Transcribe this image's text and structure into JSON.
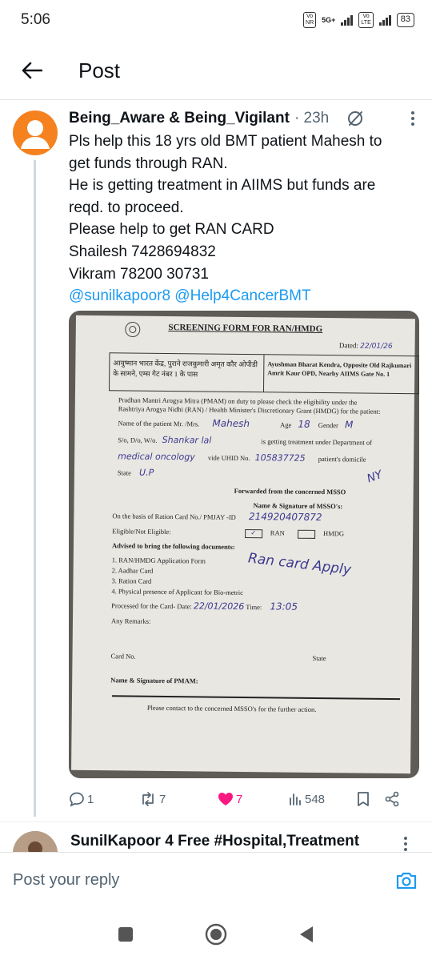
{
  "status_bar": {
    "time": "5:06",
    "sim1": "Vo\nNR",
    "network": "5G+",
    "sim2": "Vo\nLTE",
    "battery": "83"
  },
  "header": {
    "title": "Post",
    "back_icon": "arrow-left-icon"
  },
  "tweet": {
    "author": "Being_Aware & Being_Vigilant",
    "separator": " · ",
    "age": "23h",
    "lines": [
      "Pls help this 18 yrs old BMT patient Mahesh to",
      "get funds through RAN.",
      "He is getting treatment in AIIMS but funds are",
      "reqd. to proceed.",
      "Please help to get RAN CARD",
      "Shailesh 7428694832",
      "Vikram 78200 30731"
    ],
    "mentions": "@sunilkapoor8 @Help4CancerBMT",
    "actions": {
      "replies": "1",
      "retweets": "7",
      "likes": "7",
      "views": "548"
    },
    "colors": {
      "like": "#f91880",
      "mention": "#1d9bf0",
      "avatar": "#f5821f"
    }
  },
  "document": {
    "title": "SCREENING FORM FOR RAN/HMDG",
    "dated_label": "Dated:",
    "dated_value": "22/01/26",
    "box_left": "आयुष्मान भारत केंद्र, पुराने राजकुमारी अमृत कौर ओपीडी के सामने, एम्स गेट नंबर 1 के पास",
    "box_right": "Ayushman Bharat Kendra, Opposite Old Rajkumari Amrit Kaur OPD, Nearby AIIMS Gate No. 1",
    "intro": "Pradhan Mantri Arogya Mitra (PMAM) on duty to please check the eligibility under the Rashtriya Arogya Nidhi (RAN) / Health Minister's Discretionary Grant (HMDG) for the patient:",
    "name_label": "Name of the patient Mr. /Mrs.",
    "name_value": "Mahesh",
    "age_label": "Age",
    "age_value": "18",
    "gender_label": "Gender",
    "gender_value": "M",
    "sdw_label": "S/o, D/o, W/o.",
    "sdw_value": "Shankar lal",
    "dept_label": "is getting treatment under Department of",
    "dept_value": "medical oncology",
    "uhid_label": "vide UHID No.",
    "uhid_value": "105837725",
    "domicile_label": "patient's domicile",
    "state_label": "State",
    "state_value": "U.P",
    "forwarded": "Forwarded from the concerned MSSO",
    "msso_sign": "Name & Signature of MSSO's:",
    "ration_label": "On the basis of Ration Card No./ PMJAY -ID",
    "ration_value": "214920407872",
    "eligible_label": "Eligible/Not Eligible:",
    "ran_label": "RAN",
    "hmdg_label": "HMDG",
    "advised": "Advised to bring the following documents:",
    "docs": [
      "1.  RAN/HMDG Application Form",
      "2.  Aadhar Card",
      "3.  Ration Card",
      "4.  Physical presence of Applicant for Bio-metric"
    ],
    "handwritten_note": "Ran card Apply",
    "processed_label": "Processed for the Card- Date:",
    "processed_date": "22/01/2026",
    "time_label": "Time:",
    "time_value": "13:05",
    "remarks": "Any Remarks:",
    "card_no": "Card No.",
    "state_footer": "State",
    "pmam_sign": "Name & Signature of PMAM:",
    "footer": "Please contact to the concerned MSSO's for the further action.",
    "signature": "NY"
  },
  "next_reply": {
    "author": "SunilKapoor 4 Free #Hospital,Treatment"
  },
  "compose": {
    "placeholder": "Post your reply"
  }
}
